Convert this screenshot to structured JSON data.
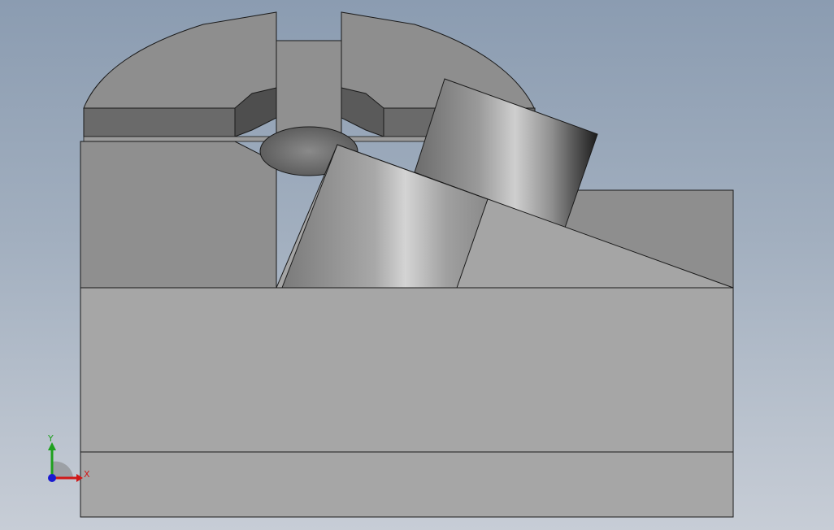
{
  "viewport": {
    "background_top": "#8b9cb1",
    "background_bottom": "#c7cdd6"
  },
  "triad": {
    "x_label": "X",
    "y_label": "Y",
    "x_color": "#d01818",
    "y_color": "#1ea01e",
    "z_color": "#1a1ad0"
  },
  "model": {
    "face_light": "#a6a6a6",
    "face_mid": "#8e8e8e",
    "face_dark": "#636363",
    "edge_color": "#1a1a1a"
  }
}
